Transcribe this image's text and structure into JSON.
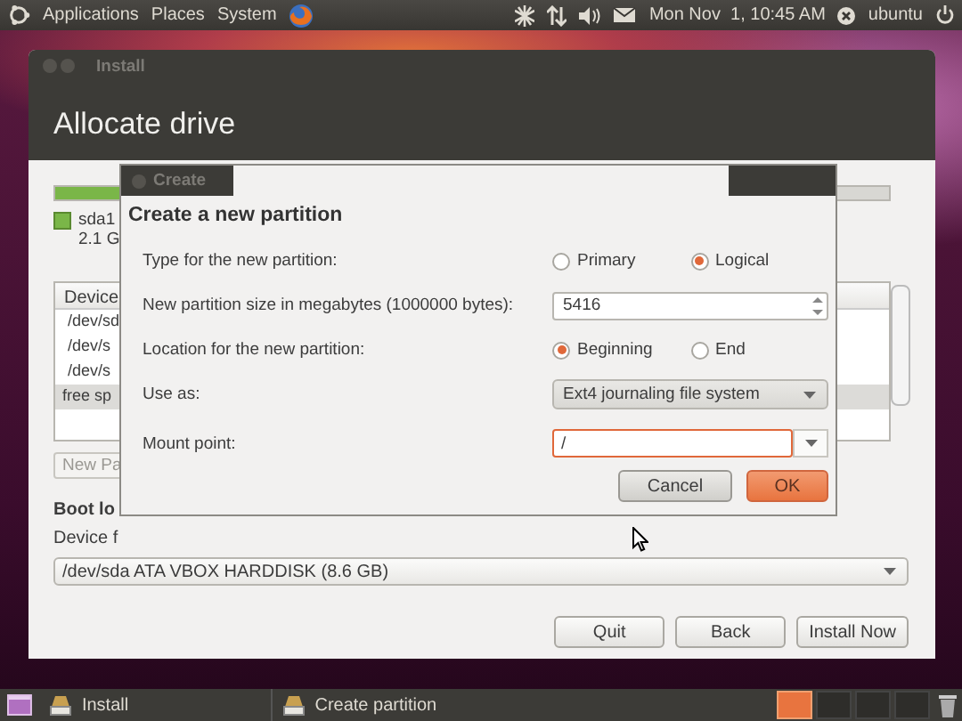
{
  "panel": {
    "menus": [
      "Applications",
      "Places",
      "System"
    ],
    "clock": "Mon Nov  1, 10:45 AM",
    "user": "ubuntu"
  },
  "installer": {
    "title": "Install",
    "heading": "Allocate drive",
    "legend": {
      "name": "sda1",
      "size": "2.1 G",
      "color": "#7ab648"
    },
    "table": {
      "header": "Device",
      "rows": [
        {
          "text": "/dev/sd",
          "selected": false
        },
        {
          "text": "/dev/s",
          "selected": false
        },
        {
          "text": "/dev/s",
          "selected": false
        },
        {
          "text": "free sp",
          "selected": true
        }
      ]
    },
    "new_button": "New Pa",
    "boot_heading": "Boot lo",
    "device_label": "Device f",
    "device": "/dev/sda ATA VBOX HARDDISK (8.6 GB)",
    "buttons": [
      "Quit",
      "Back",
      "Install Now"
    ]
  },
  "dialog": {
    "title": "Create",
    "heading": "Create a new partition",
    "rows": [
      {
        "kind": "radio",
        "label": "Type for the new partition:",
        "options": [
          {
            "label": "Primary",
            "selected": false
          },
          {
            "label": "Logical",
            "selected": true
          }
        ]
      },
      {
        "kind": "spin",
        "label": "New partition size in megabytes (1000000 bytes):",
        "value": "5416"
      },
      {
        "kind": "radio",
        "label": "Location for the new partition:",
        "options": [
          {
            "label": "Beginning",
            "selected": true
          },
          {
            "label": "End",
            "selected": false
          }
        ]
      },
      {
        "kind": "combo",
        "label": "Use as:",
        "value": "Ext4 journaling file system"
      },
      {
        "kind": "entry",
        "label": "Mount point:",
        "value": "/"
      }
    ],
    "buttons": [
      {
        "label": "Cancel",
        "kind": "normal"
      },
      {
        "label": "OK",
        "kind": "default"
      }
    ]
  },
  "taskbar": {
    "tasks": [
      "Install",
      "Create partition"
    ],
    "workspaces": [
      {
        "selected": true
      },
      {
        "selected": false
      },
      {
        "selected": false
      },
      {
        "selected": false
      }
    ]
  }
}
